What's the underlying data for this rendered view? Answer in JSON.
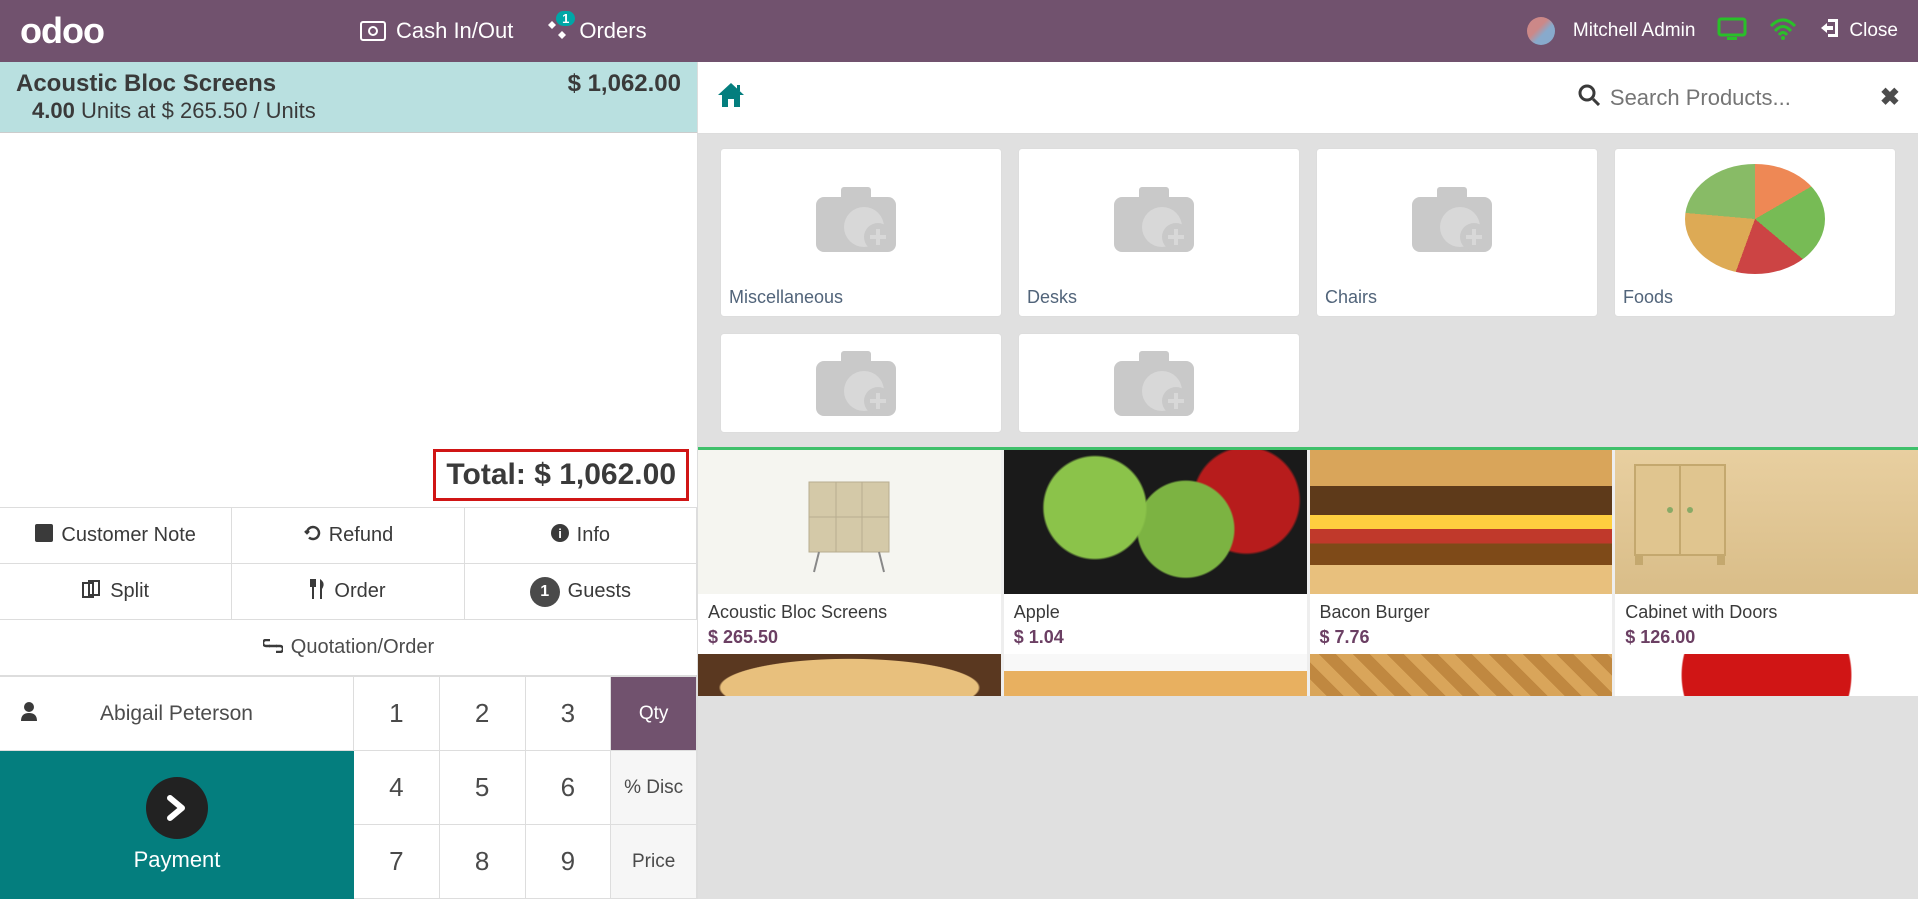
{
  "topbar": {
    "logo": "odoo",
    "cash": "Cash In/Out",
    "orders": "Orders",
    "orders_badge": "1",
    "user": "Mitchell Admin",
    "close": "Close"
  },
  "order": {
    "line": {
      "name": "Acoustic Bloc Screens",
      "price": "$ 1,062.00",
      "qty": "4.00",
      "detail_prefix": "Units at",
      "unit_price": "$ 265.50",
      "unit_suffix": "/ Units"
    },
    "total_label": "Total:",
    "total_value": "$ 1,062.00"
  },
  "controls": {
    "customer_note": "Customer Note",
    "refund": "Refund",
    "info": "Info",
    "split": "Split",
    "order": "Order",
    "guests": "Guests",
    "guests_count": "1",
    "quotation": "Quotation/Order"
  },
  "customer": "Abigail Peterson",
  "payment": "Payment",
  "numpad": {
    "keys": [
      "1",
      "2",
      "3",
      "4",
      "5",
      "6",
      "7",
      "8",
      "9"
    ],
    "qty": "Qty",
    "disc": "% Disc",
    "price": "Price"
  },
  "search": {
    "placeholder": "Search Products..."
  },
  "categories": [
    {
      "name": "Miscellaneous",
      "img": "placeholder"
    },
    {
      "name": "Desks",
      "img": "placeholder"
    },
    {
      "name": "Chairs",
      "img": "placeholder"
    },
    {
      "name": "Foods",
      "img": "food"
    }
  ],
  "categories_row2": [
    {
      "name": "",
      "img": "placeholder"
    },
    {
      "name": "",
      "img": "placeholder"
    }
  ],
  "products": [
    {
      "name": "Acoustic Bloc Screens",
      "price": "$ 265.50",
      "img": "screen"
    },
    {
      "name": "Apple",
      "price": "$ 1.04",
      "img": "apples"
    },
    {
      "name": "Bacon Burger",
      "price": "$ 7.76",
      "img": "burger"
    },
    {
      "name": "Cabinet with Doors",
      "price": "$ 126.00",
      "img": "cabinet"
    }
  ]
}
